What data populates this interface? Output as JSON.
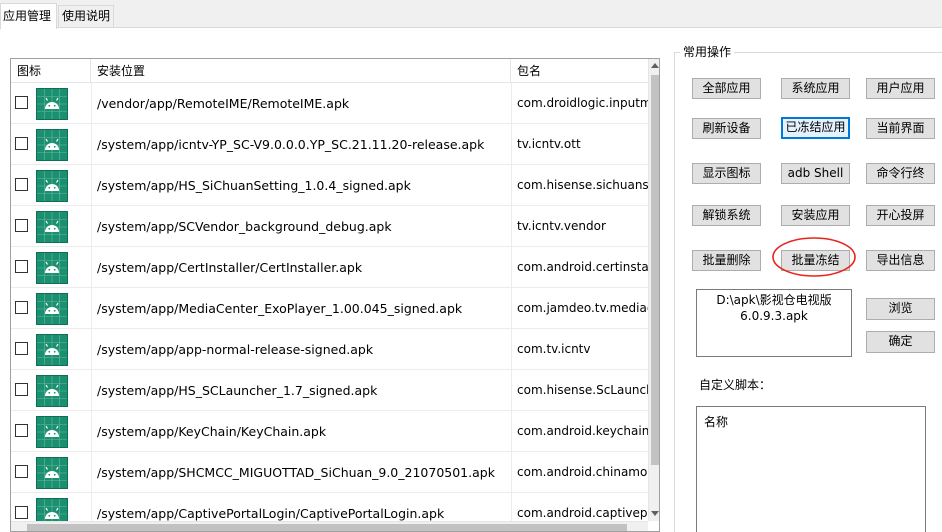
{
  "tabs": [
    {
      "label": "应用管理",
      "active": true
    },
    {
      "label": "使用说明",
      "active": false
    }
  ],
  "list": {
    "columns": [
      "图标",
      "安装位置",
      "包名"
    ],
    "rows": [
      {
        "path": "/vendor/app/RemoteIME/RemoteIME.apk",
        "package": "com.droidlogic.inputmethod"
      },
      {
        "path": "/system/app/icntv-YP_SC-V9.0.0.0.YP_SC.21.11.20-release.apk",
        "package": "tv.icntv.ott"
      },
      {
        "path": "/system/app/HS_SiChuanSetting_1.0.4_signed.apk",
        "package": "com.hisense.sichuansetting"
      },
      {
        "path": "/system/app/SCVendor_background_debug.apk",
        "package": "tv.icntv.vendor"
      },
      {
        "path": "/system/app/CertInstaller/CertInstaller.apk",
        "package": "com.android.certinstaller"
      },
      {
        "path": "/system/app/MediaCenter_ExoPlayer_1.00.045_signed.apk",
        "package": "com.jamdeo.tv.mediacenter"
      },
      {
        "path": "/system/app/app-normal-release-signed.apk",
        "package": "com.tv.icntv"
      },
      {
        "path": "/system/app/HS_SCLauncher_1.7_signed.apk",
        "package": "com.hisense.ScLauncher"
      },
      {
        "path": "/system/app/KeyChain/KeyChain.apk",
        "package": "com.android.keychain"
      },
      {
        "path": "/system/app/SHCMCC_MIGUOTTAD_SiChuan_9.0_21070501.apk",
        "package": "com.android.chinamobile"
      },
      {
        "path": "/system/app/CaptivePortalLogin/CaptivePortalLogin.apk",
        "package": "com.android.captiveportallogin"
      }
    ]
  },
  "ops": {
    "title": "常用操作",
    "buttons": {
      "all_apps": "全部应用",
      "system_apps": "系统应用",
      "user_apps": "用户应用",
      "refresh_device": "刷新设备",
      "frozen_apps": "已冻结应用",
      "current_screen": "当前界面",
      "show_icons": "显示图标",
      "adb_shell": "adb Shell",
      "command_line": "命令行终",
      "unlock_system": "解锁系统",
      "install_app": "安装应用",
      "screen_cast": "开心投屏",
      "batch_delete": "批量删除",
      "batch_freeze": "批量冻结",
      "export_info": "导出信息",
      "browse": "浏览",
      "confirm": "确定"
    },
    "apk_path": "D:\\apk\\影视仓电视版6.0.9.3.apk",
    "script_label": "自定义脚本：",
    "script_header": "名称"
  },
  "colors": {
    "accent": "#0078d7",
    "annotation": "#e8241c",
    "icon_bg": "#1a9070"
  }
}
